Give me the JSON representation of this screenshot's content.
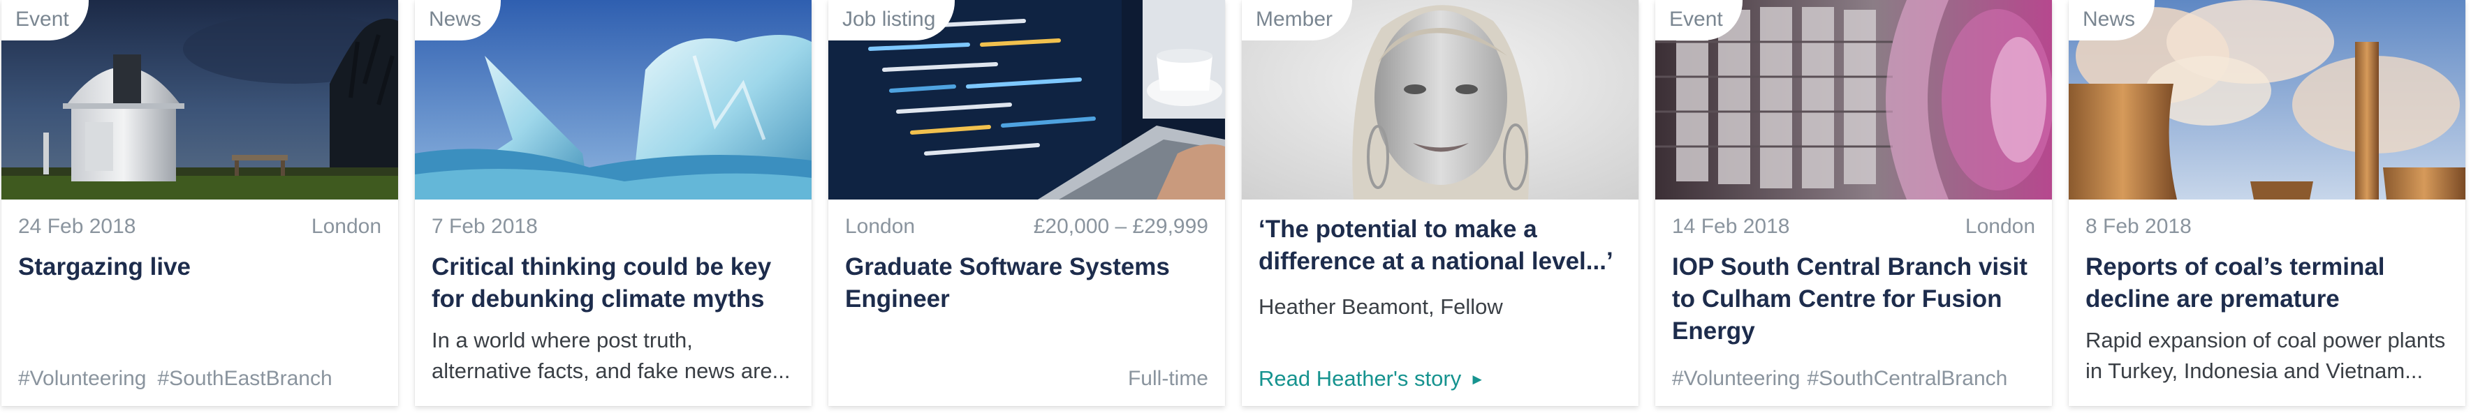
{
  "cards": [
    {
      "badge": "Event",
      "date": "24 Feb 2018",
      "location": "London",
      "title": "Stargazing live",
      "tags": [
        "#Volunteering",
        "#SouthEastBranch"
      ]
    },
    {
      "badge": "News",
      "date": "7 Feb 2018",
      "title": "Critical thinking could be key for debunking climate myths",
      "description": "In a world where post truth, alternative facts, and fake news are..."
    },
    {
      "badge": "Job listing",
      "location": "London",
      "salary": "£20,000 – £29,999",
      "title": "Graduate Software Systems Engineer",
      "contract": "Full-time"
    },
    {
      "badge": "Member",
      "quote": "‘The potential to make a difference at a national level...’",
      "person": "Heather Beamont, Fellow",
      "cta": "Read Heather's story",
      "cta_arrow": "►"
    },
    {
      "badge": "Event",
      "date": "14 Feb 2018",
      "location": "London",
      "title": "IOP South Central Branch visit to Culham Centre for Fusion Energy",
      "tags": [
        "#Volunteering",
        "#SouthCentralBranch"
      ]
    },
    {
      "badge": "News",
      "date": "8 Feb 2018",
      "title": "Reports of coal’s terminal decline are premature",
      "description": "Rapid expansion of coal power plants in Turkey, Indonesia and Vietnam..."
    }
  ]
}
